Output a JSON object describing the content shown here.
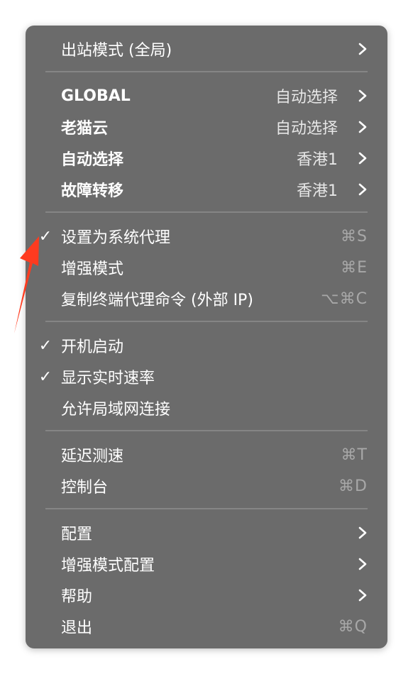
{
  "menu": {
    "outbound_mode": {
      "label": "出站模式 (全局)"
    },
    "policy_groups": [
      {
        "label": "GLOBAL",
        "value": "自动选择"
      },
      {
        "label": "老猫云",
        "value": "自动选择"
      },
      {
        "label": "自动选择",
        "value": "香港1"
      },
      {
        "label": "故障转移",
        "value": "香港1"
      }
    ],
    "proxy_section": [
      {
        "label": "设置为系统代理",
        "checked": true,
        "check_mark": "✓",
        "shortcut": "⌘S"
      },
      {
        "label": "增强模式",
        "checked": false,
        "check_mark": "",
        "shortcut": "⌘E"
      },
      {
        "label": "复制终端代理命令 (外部 IP)",
        "checked": false,
        "check_mark": "",
        "shortcut": "⌥⌘C"
      }
    ],
    "startup_section": [
      {
        "label": "开机启动",
        "checked": true,
        "check_mark": "✓"
      },
      {
        "label": "显示实时速率",
        "checked": true,
        "check_mark": "✓"
      },
      {
        "label": "允许局域网连接",
        "checked": false,
        "check_mark": ""
      }
    ],
    "tools_section": [
      {
        "label": "延迟测速",
        "shortcut": "⌘T"
      },
      {
        "label": "控制台",
        "shortcut": "⌘D"
      }
    ],
    "config_section": [
      {
        "label": "配置"
      },
      {
        "label": "增强模式配置"
      },
      {
        "label": "帮助"
      },
      {
        "label": "退出",
        "shortcut": "⌘Q"
      }
    ]
  },
  "colors": {
    "menu_bg": "#6b6b6b",
    "text": "#ffffff",
    "shortcut": "#a8a8a8",
    "separator": "#858585",
    "annotation_arrow": "#ff3b1f"
  }
}
